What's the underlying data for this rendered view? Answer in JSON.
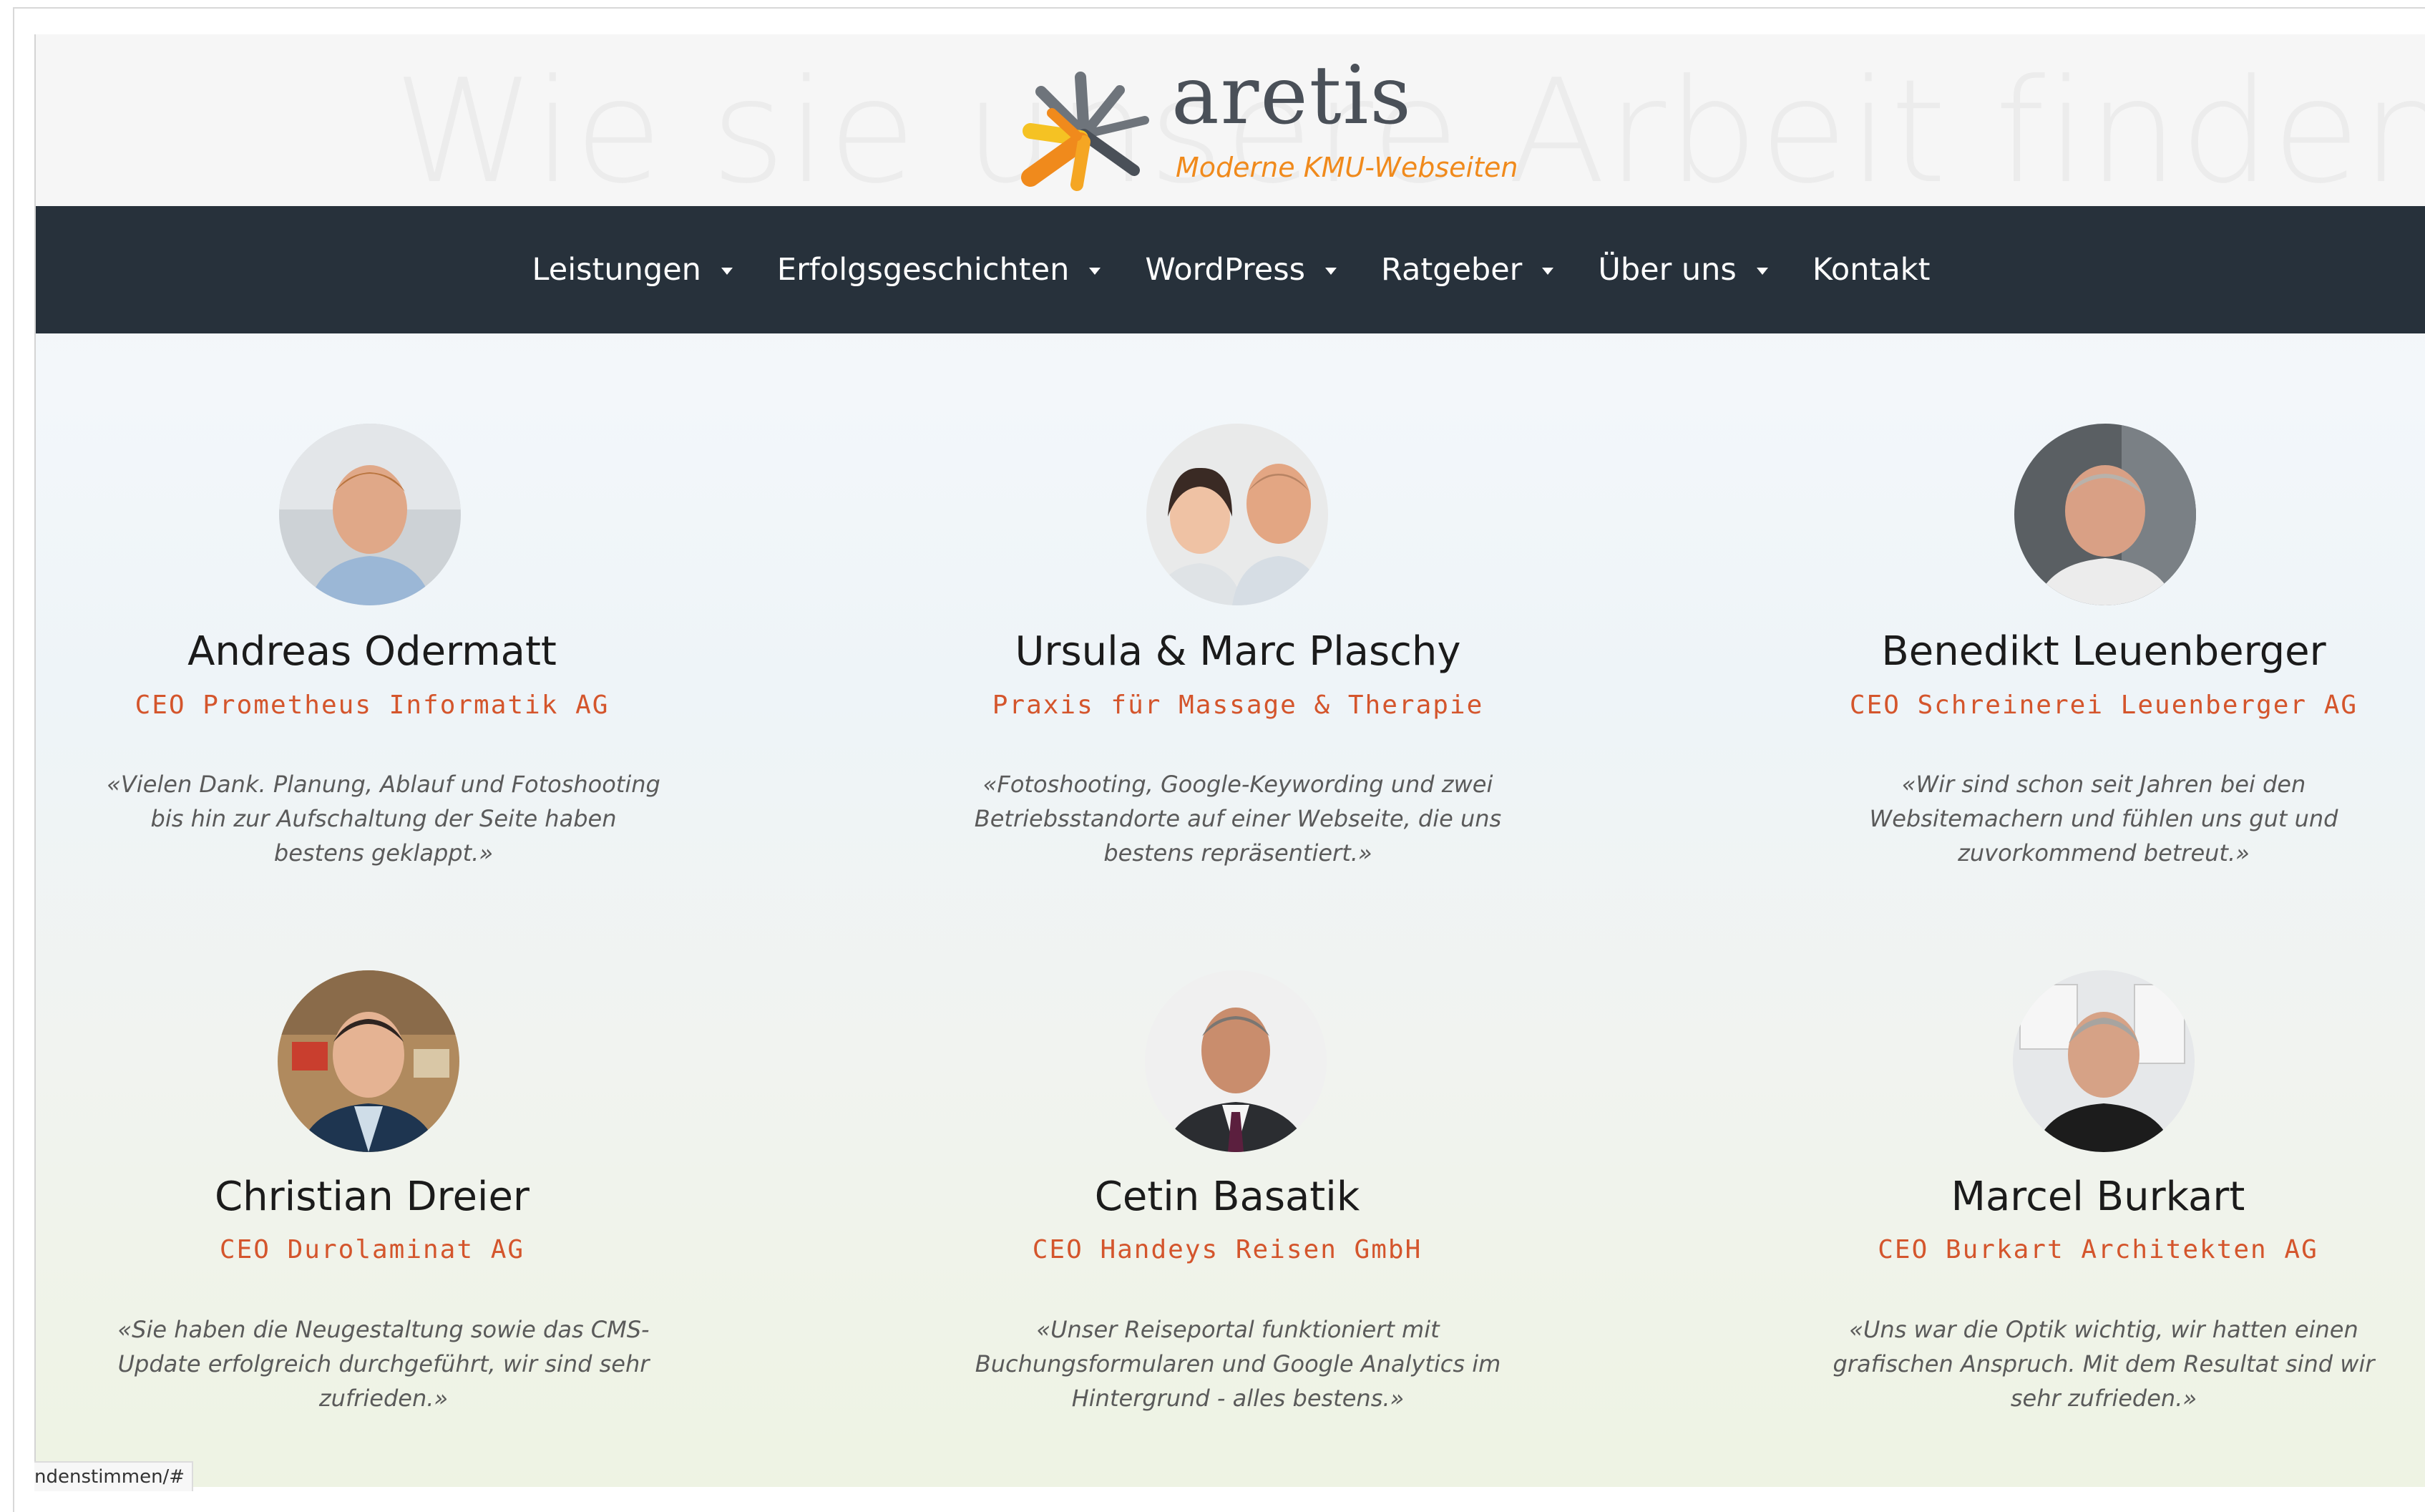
{
  "header": {
    "watermark_text": "Wie sie unsere Arbeit finden",
    "logo": {
      "name": "aretis",
      "tagline": "Moderne KMU-Webseiten",
      "accent_color": "#f08a1c"
    }
  },
  "nav": {
    "background": "#27313b",
    "items": [
      {
        "label": "Leistungen",
        "has_dropdown": true
      },
      {
        "label": "Erfolgsgeschichten",
        "has_dropdown": true
      },
      {
        "label": "WordPress",
        "has_dropdown": true
      },
      {
        "label": "Ratgeber",
        "has_dropdown": true
      },
      {
        "label": "Über uns",
        "has_dropdown": true
      },
      {
        "label": "Kontakt",
        "has_dropdown": false
      }
    ]
  },
  "testimonials": [
    {
      "name": "Andreas Odermatt",
      "role": "CEO Prometheus Informatik AG",
      "quote": "«Vielen Dank. Planung, Ablauf und Fotoshooting bis hin zur Aufschaltung der Seite haben bestens geklappt.»"
    },
    {
      "name": "Ursula & Marc Plaschy",
      "role": "Praxis für Massage & Therapie",
      "quote": "«Fotoshooting, Google-Keywording und zwei Betriebsstandorte auf einer Webseite, die uns bestens repräsentiert.»"
    },
    {
      "name": "Benedikt Leuenberger",
      "role": "CEO Schreinerei Leuenberger AG",
      "quote": "«Wir sind schon seit Jahren bei den Websitemachern und fühlen uns gut und zuvorkommend betreut.»"
    },
    {
      "name": "Christian Dreier",
      "role": "CEO Durolaminat AG",
      "quote": "«Sie haben die Neugestaltung sowie das CMS-Update erfolgreich durchgeführt, wir sind sehr zufrieden.»"
    },
    {
      "name": "Cetin Basatik",
      "role": "CEO Handeys Reisen GmbH",
      "quote": "«Unser Reiseportal funktioniert mit Buchungsformularen und Google Analytics im Hintergrund - alles bestens.»"
    },
    {
      "name": "Marcel Burkart",
      "role": "CEO Burkart Architekten AG",
      "quote": "«Uns war die Optik wichtig, wir hatten einen grafischen Anspruch. Mit dem Resultat sind wir sehr zufrieden.»"
    }
  ],
  "colors": {
    "role_text": "#d4552c",
    "name_text": "#1b1b1b",
    "quote_text": "#5a5a5a"
  },
  "status_bar": {
    "url_fragment": "ndenstimmen/#"
  }
}
